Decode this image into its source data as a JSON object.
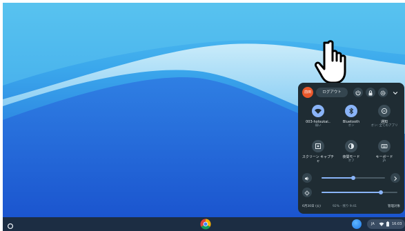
{
  "quick_settings": {
    "avatar_text": "前田",
    "logout_label": "ログアウト",
    "tiles": [
      {
        "label": "003-hotsukai..",
        "sublabel": "弱い",
        "state": "on",
        "icon": "wifi-icon"
      },
      {
        "label": "Bluetooth",
        "sublabel": "オン",
        "state": "on",
        "icon": "bluetooth-icon"
      },
      {
        "label": "通知",
        "sublabel": "オン: 全てのアプリ",
        "state": "off",
        "icon": "notifications-icon"
      },
      {
        "label": "スクリーン キャプチャ",
        "sublabel": "",
        "state": "off",
        "icon": "screen-capture-icon"
      },
      {
        "label": "夜間モード",
        "sublabel": "オフ",
        "state": "off",
        "icon": "night-light-icon"
      },
      {
        "label": "キーボード",
        "sublabel": "JA",
        "state": "off",
        "icon": "keyboard-icon"
      }
    ],
    "volume_level": 0.5,
    "brightness_level": 0.78,
    "footer": {
      "date": "6月30日 (火)",
      "battery": "92% - 残り 9:41",
      "manage": "管理対象"
    }
  },
  "shelf": {
    "ime_label": "JA",
    "clock": "16:03"
  },
  "colors": {
    "panel_bg": "#1f2c33",
    "accent": "#8ab4f8",
    "avatar": "#e8562a",
    "shelf_bg": "#1c2d43"
  }
}
